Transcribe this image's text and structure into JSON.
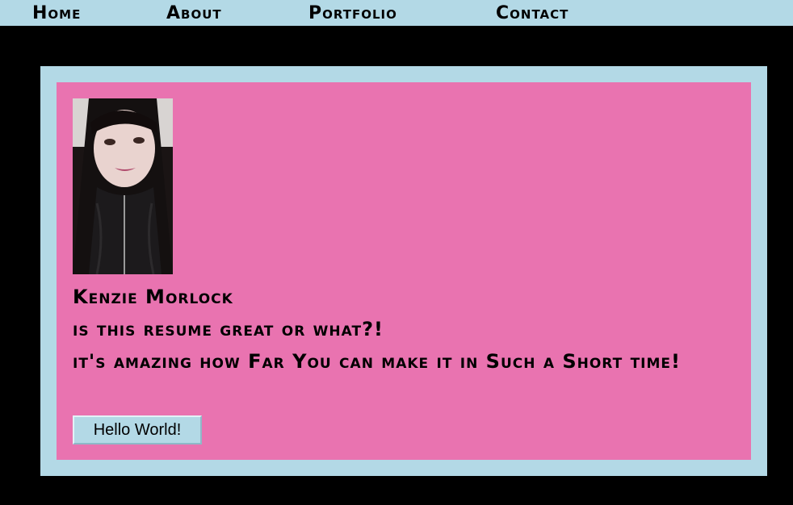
{
  "nav": {
    "items": [
      {
        "label": "Home"
      },
      {
        "label": "About"
      },
      {
        "label": "Portfolio"
      },
      {
        "label": "Contact"
      }
    ]
  },
  "profile": {
    "name": "Kenzie Morlock",
    "line1": "is this resume great or what?!",
    "line2": "it's amazing how Far You can make it in Such a Short time!",
    "button_label": "Hello World!"
  },
  "colors": {
    "nav_background": "#b3d9e6",
    "frame": "#b3d9e6",
    "card": "#e973b0",
    "page_background": "#000000"
  }
}
